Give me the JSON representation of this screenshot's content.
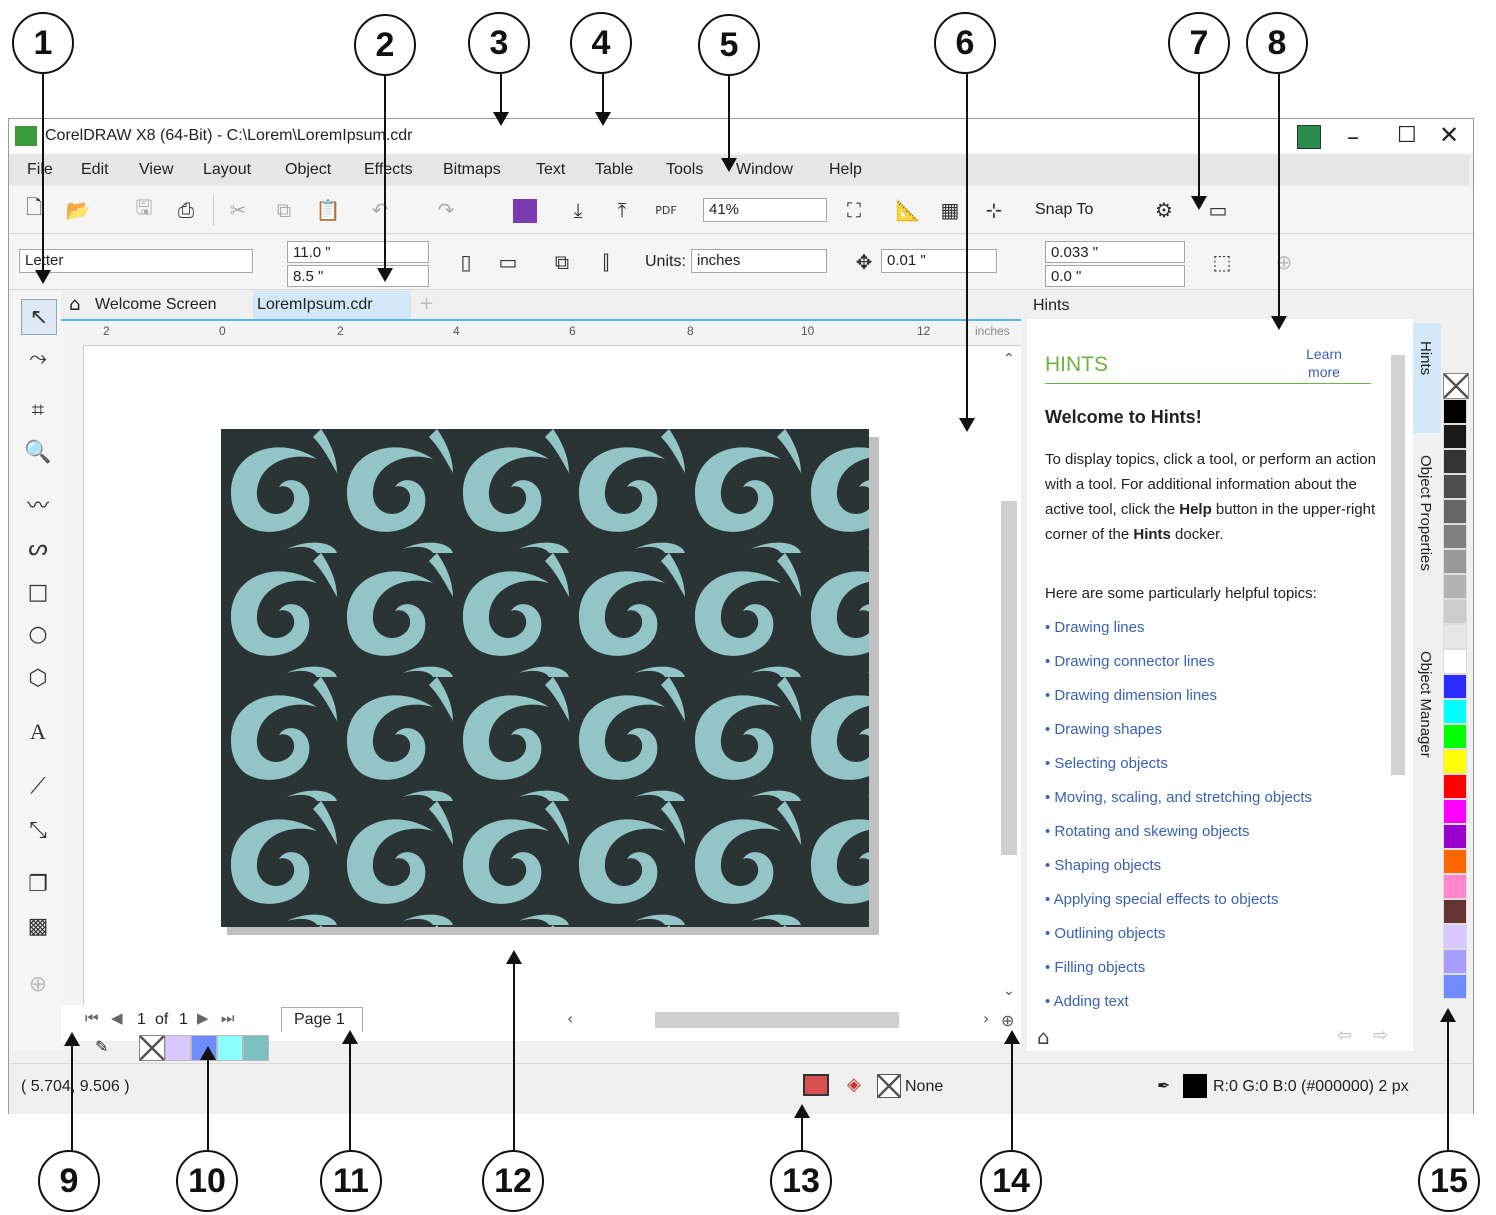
{
  "callouts": [
    "1",
    "2",
    "3",
    "4",
    "5",
    "6",
    "7",
    "8",
    "9",
    "10",
    "11",
    "12",
    "13",
    "14",
    "15"
  ],
  "window": {
    "title": "CorelDRAW X8 (64-Bit) - C:\\Lorem\\LoremIpsum.cdr"
  },
  "menu": [
    "File",
    "Edit",
    "View",
    "Layout",
    "Object",
    "Effects",
    "Bitmaps",
    "Text",
    "Table",
    "Tools",
    "Window",
    "Help"
  ],
  "toolbar": {
    "zoom": "41%",
    "snap": "Snap To"
  },
  "propbar": {
    "page_size": "Letter",
    "width": "11.0 \"",
    "height": "8.5 \"",
    "units_label": "Units:",
    "units": "inches",
    "nudge": "0.01 \"",
    "dup_x": "0.033 \"",
    "dup_y": "0.0 \""
  },
  "tabs": {
    "welcome": "Welcome Screen",
    "doc": "LoremIpsum.cdr"
  },
  "ruler": {
    "unit": "inches",
    "h_ticks": [
      "2",
      "0",
      "2",
      "4",
      "6",
      "8",
      "10",
      "12"
    ]
  },
  "page_nav": {
    "current": "1",
    "of": "of",
    "total": "1",
    "page_tab": "Page 1"
  },
  "status": {
    "coords": "( 5.704, 9.506 )",
    "fill": "None",
    "outline": "R:0 G:0 B:0 (#000000)  2 px"
  },
  "docker": {
    "title": "Hints",
    "heading": "HINTS",
    "learn_more": "Learn more",
    "welcome": "Welcome to Hints!",
    "intro_parts": [
      "To display topics, click a tool, or perform an action with a tool. For additional information about the active tool, click the ",
      "Help",
      " button in the upper-right corner of the ",
      "Hints",
      " docker."
    ],
    "topics_intro": "Here are some particularly helpful topics:",
    "topics": [
      "Drawing lines",
      "Drawing connector lines",
      "Drawing dimension lines",
      "Drawing shapes",
      "Selecting objects",
      "Moving, scaling, and stretching objects",
      "Rotating and skewing objects",
      "Shaping objects",
      "Applying special effects to objects",
      "Outlining objects",
      "Filling objects",
      "Adding text"
    ],
    "side_tabs": [
      "Hints",
      "Object Properties",
      "Object Manager"
    ]
  },
  "colors": {
    "pattern_bg": "#2b3434",
    "pattern_fg": "#93c4c6",
    "hints_green": "#6cb33f",
    "link": "#3a62b0",
    "accent": "#5bb2e6"
  },
  "palette": [
    "#000000",
    "#1a1a1a",
    "#333333",
    "#4d4d4d",
    "#666666",
    "#808080",
    "#999999",
    "#b3b3b3",
    "#cccccc",
    "#e6e6e6",
    "#ffffff",
    "#2b2bff",
    "#00ffff",
    "#00ff00",
    "#ffff00",
    "#ff0000",
    "#ff00ff",
    "#9900cc",
    "#ff6600",
    "#ff88cc",
    "#663333",
    "#d9c8ff",
    "#a79cff",
    "#6f8cff"
  ],
  "doc_palette": [
    "#d9c8ff",
    "#6f8cff",
    "#8effff",
    "#7ac0c0"
  ],
  "icons": [
    "new-icon",
    "open-icon",
    "save-icon",
    "print-icon",
    "undo-icon",
    "redo-icon",
    "import-icon",
    "export-icon",
    "pdf-icon",
    "gear-icon",
    "pick-tool-icon",
    "shape-tool-icon",
    "crop-tool-icon",
    "zoom-tool-icon",
    "freehand-tool-icon",
    "rectangle-tool-icon",
    "ellipse-tool-icon",
    "polygon-tool-icon",
    "text-tool-icon",
    "connector-tool-icon",
    "transparency-tool-icon",
    "home-icon",
    "close-icon",
    "minimize-icon",
    "maximize-icon"
  ]
}
